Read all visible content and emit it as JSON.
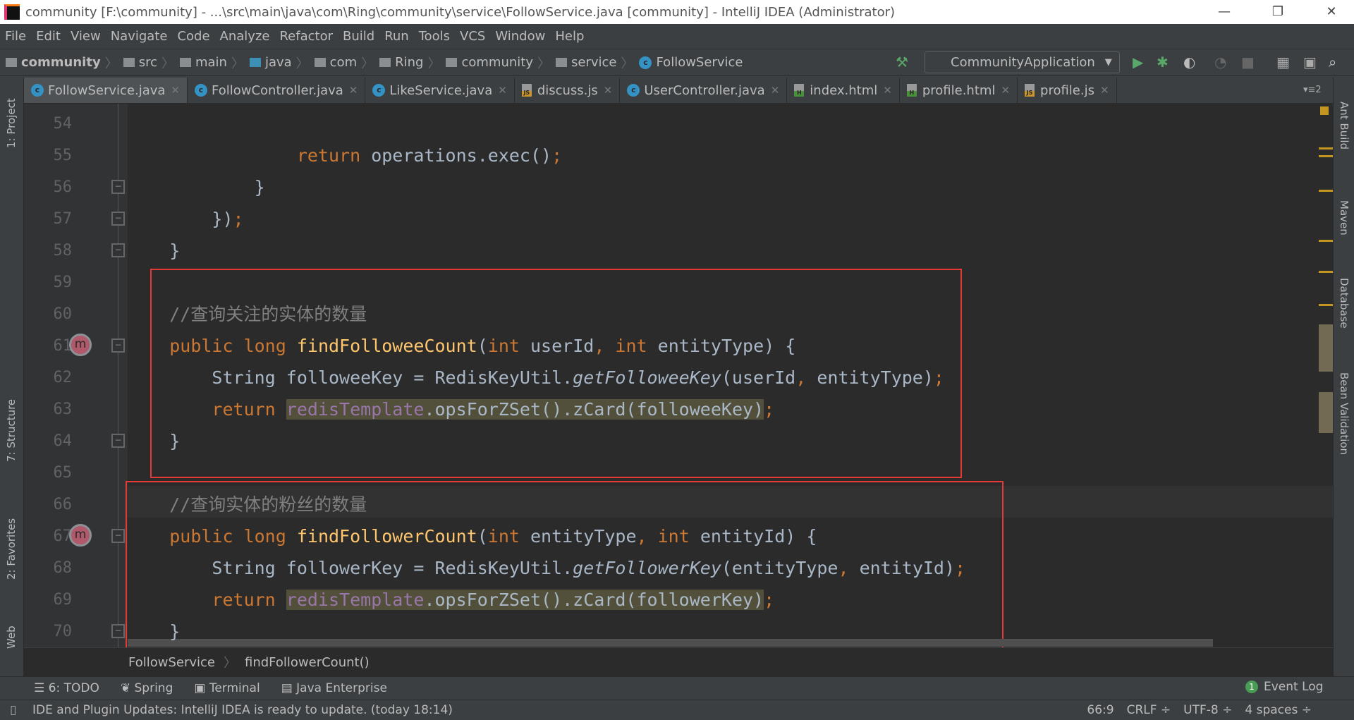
{
  "window": {
    "title": "community [F:\\community] - ...\\src\\main\\java\\com\\Ring\\community\\service\\FollowService.java [community] - IntelliJ IDEA (Administrator)",
    "minimize": "—",
    "maximize": "❐",
    "close": "✕"
  },
  "menu": [
    "File",
    "Edit",
    "View",
    "Navigate",
    "Code",
    "Analyze",
    "Refactor",
    "Build",
    "Run",
    "Tools",
    "VCS",
    "Window",
    "Help"
  ],
  "nav": {
    "crumbs": [
      "community",
      "src",
      "main",
      "java",
      "com",
      "Ring",
      "community",
      "service",
      "FollowService"
    ],
    "run_config": "CommunityApplication"
  },
  "tabs": [
    {
      "label": "FollowService.java",
      "type": "java",
      "active": true
    },
    {
      "label": "FollowController.java",
      "type": "java"
    },
    {
      "label": "LikeService.java",
      "type": "java"
    },
    {
      "label": "discuss.js",
      "type": "js"
    },
    {
      "label": "UserController.java",
      "type": "java"
    },
    {
      "label": "index.html",
      "type": "html"
    },
    {
      "label": "profile.html",
      "type": "html"
    },
    {
      "label": "profile.js",
      "type": "js"
    }
  ],
  "tab_count": "2",
  "left_tools": [
    "1: Project",
    "7: Structure",
    "2: Favorites",
    "Web"
  ],
  "right_tools": [
    "Ant Build",
    "Maven",
    "Database",
    "Bean Validation"
  ],
  "editor": {
    "current_line": 66,
    "lines": [
      {
        "n": "54",
        "seg": []
      },
      {
        "n": "55",
        "seg": [
          [
            "                ",
            ""
          ],
          [
            "return",
            "kw"
          ],
          [
            " operations.exec()",
            ""
          ],
          [
            ";",
            "kw"
          ]
        ]
      },
      {
        "n": "56",
        "seg": [
          [
            "            }",
            ""
          ]
        ]
      },
      {
        "n": "57",
        "seg": [
          [
            "        })",
            ""
          ],
          [
            ";",
            "kw"
          ]
        ]
      },
      {
        "n": "58",
        "seg": [
          [
            "    }",
            ""
          ]
        ]
      },
      {
        "n": "59",
        "seg": []
      },
      {
        "n": "60",
        "seg": [
          [
            "    //查询关注的实体的数量",
            "cm"
          ]
        ]
      },
      {
        "n": "61",
        "seg": [
          [
            "    ",
            ""
          ],
          [
            "public long ",
            "kw"
          ],
          [
            "findFolloweeCount",
            "fn"
          ],
          [
            "(",
            ""
          ],
          [
            "int ",
            "kw"
          ],
          [
            "userId",
            ""
          ],
          [
            ", ",
            "kw"
          ],
          [
            "int ",
            "kw"
          ],
          [
            "entityType) {",
            ""
          ]
        ]
      },
      {
        "n": "62",
        "seg": [
          [
            "        String followeeKey = RedisKeyUtil.",
            ""
          ],
          [
            "getFolloweeKey",
            "it"
          ],
          [
            "(userId",
            ""
          ],
          [
            ", ",
            "kw"
          ],
          [
            "entityType)",
            ""
          ],
          [
            ";",
            "kw"
          ]
        ]
      },
      {
        "n": "63",
        "seg": [
          [
            "        ",
            ""
          ],
          [
            "return ",
            "kw"
          ],
          [
            "redisTemplate",
            "fld hl"
          ],
          [
            ".opsForZSet().zCard(followeeKey)",
            "hl"
          ],
          [
            ";",
            "kw"
          ]
        ]
      },
      {
        "n": "64",
        "seg": [
          [
            "    }",
            ""
          ]
        ]
      },
      {
        "n": "65",
        "seg": []
      },
      {
        "n": "66",
        "seg": [
          [
            "    //查询实体的粉丝的数量",
            "cm"
          ]
        ]
      },
      {
        "n": "67",
        "seg": [
          [
            "    ",
            ""
          ],
          [
            "public long ",
            "kw"
          ],
          [
            "findFollowerCount",
            "fn"
          ],
          [
            "(",
            ""
          ],
          [
            "int ",
            "kw"
          ],
          [
            "entityType",
            ""
          ],
          [
            ", ",
            "kw"
          ],
          [
            "int ",
            "kw"
          ],
          [
            "entityId) {",
            ""
          ]
        ]
      },
      {
        "n": "68",
        "seg": [
          [
            "        String followerKey = RedisKeyUtil.",
            ""
          ],
          [
            "getFollowerKey",
            "it"
          ],
          [
            "(entityType",
            ""
          ],
          [
            ", ",
            "kw"
          ],
          [
            "entityId)",
            ""
          ],
          [
            ";",
            "kw"
          ]
        ]
      },
      {
        "n": "69",
        "seg": [
          [
            "        ",
            ""
          ],
          [
            "return ",
            "kw"
          ],
          [
            "redisTemplate",
            "fld hl"
          ],
          [
            ".opsForZSet().zCard(followerKey)",
            "hl"
          ],
          [
            ";",
            "kw"
          ]
        ]
      },
      {
        "n": "70",
        "seg": [
          [
            "    }",
            ""
          ]
        ]
      }
    ]
  },
  "breadcrumb": {
    "class": "FollowService",
    "method": "findFollowerCount()"
  },
  "bottom_tools": [
    {
      "icon": "todo-icon",
      "label": "6: TODO"
    },
    {
      "icon": "spring-icon",
      "label": "Spring"
    },
    {
      "icon": "terminal-icon",
      "label": "Terminal"
    },
    {
      "icon": "java-enterprise-icon",
      "label": "Java Enterprise"
    }
  ],
  "event_log": {
    "count": "1",
    "label": "Event Log"
  },
  "status": {
    "message": "IDE and Plugin Updates: IntelliJ IDEA is ready to update. (today 18:14)",
    "position": "66:9",
    "line_sep": "CRLF ÷",
    "encoding": "UTF-8 ÷",
    "indent": "4 spaces ÷"
  },
  "colors": {
    "keyword": "#cc7832",
    "method": "#ffc66d",
    "field": "#9876aa",
    "comment": "#808080",
    "text": "#a9b7c6",
    "highlight_box": "#e53935"
  }
}
